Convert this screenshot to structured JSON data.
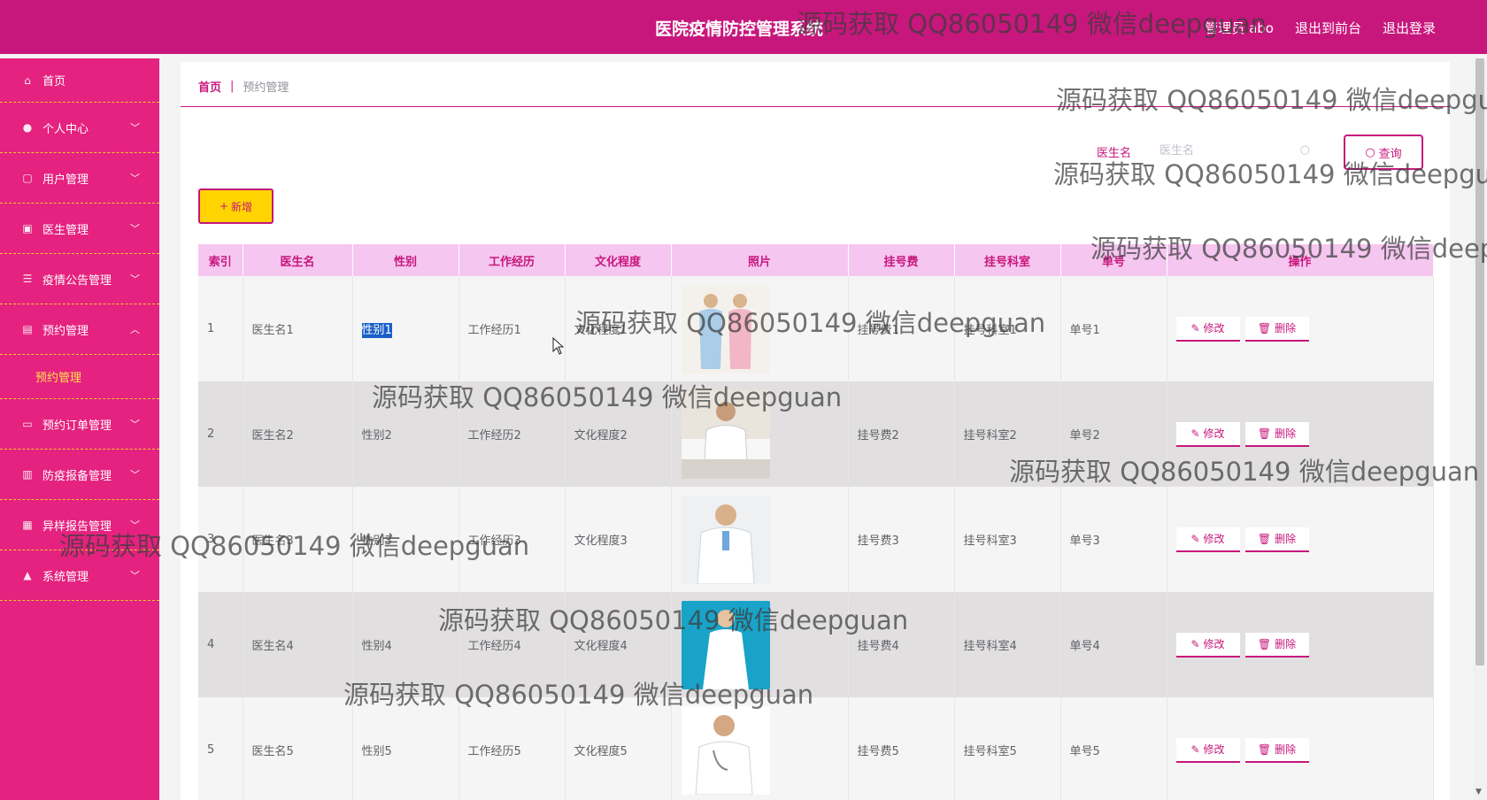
{
  "header": {
    "title": "医院疫情防控管理系统",
    "admin": "管理员 abo",
    "front": "退出到前台",
    "logout": "退出登录"
  },
  "sidebar": {
    "items": [
      {
        "label": "首页",
        "icon": "home-icon"
      },
      {
        "label": "个人中心",
        "icon": "user-icon"
      },
      {
        "label": "用户管理",
        "icon": "users-icon"
      },
      {
        "label": "医生管理",
        "icon": "doctor-icon"
      },
      {
        "label": "疫情公告管理",
        "icon": "list-icon"
      },
      {
        "label": "预约管理",
        "icon": "calendar-icon"
      },
      {
        "label": "预约订单管理",
        "icon": "order-icon"
      },
      {
        "label": "防疫报备管理",
        "icon": "report-icon"
      },
      {
        "label": "异样报告管理",
        "icon": "alert-icon"
      },
      {
        "label": "系统管理",
        "icon": "settings-icon"
      }
    ],
    "sub_item": "预约管理"
  },
  "breadcrumb": {
    "home": "首页",
    "sep": "|",
    "current": "预约管理"
  },
  "search": {
    "label": "医生名",
    "placeholder": "医生名",
    "button": "查询"
  },
  "add_button": "新增",
  "table": {
    "headers": [
      "索引",
      "医生名",
      "性别",
      "工作经历",
      "文化程度",
      "照片",
      "挂号费",
      "挂号科室",
      "单号",
      "操作"
    ],
    "rows": [
      {
        "idx": "1",
        "name": "医生名1",
        "gender": "性别1",
        "exp": "工作经历1",
        "edu": "文化程度1",
        "fee": "挂号费1",
        "dept": "挂号科室1",
        "no": "单号1"
      },
      {
        "idx": "2",
        "name": "医生名2",
        "gender": "性别2",
        "exp": "工作经历2",
        "edu": "文化程度2",
        "fee": "挂号费2",
        "dept": "挂号科室2",
        "no": "单号2"
      },
      {
        "idx": "3",
        "name": "医生名3",
        "gender": "性别3",
        "exp": "工作经历3",
        "edu": "文化程度3",
        "fee": "挂号费3",
        "dept": "挂号科室3",
        "no": "单号3"
      },
      {
        "idx": "4",
        "name": "医生名4",
        "gender": "性别4",
        "exp": "工作经历4",
        "edu": "文化程度4",
        "fee": "挂号费4",
        "dept": "挂号科室4",
        "no": "单号4"
      },
      {
        "idx": "5",
        "name": "医生名5",
        "gender": "性别5",
        "exp": "工作经历5",
        "edu": "文化程度5",
        "fee": "挂号费5",
        "dept": "挂号科室5",
        "no": "单号5"
      }
    ],
    "edit": "修改",
    "delete": "删除"
  },
  "watermark": "源码获取 QQ86050149 微信deepguan",
  "colors": {
    "primary": "#c7177c",
    "sidebar": "#e5227f",
    "accent": "#ffd400",
    "header_row": "#f5c6f0"
  }
}
